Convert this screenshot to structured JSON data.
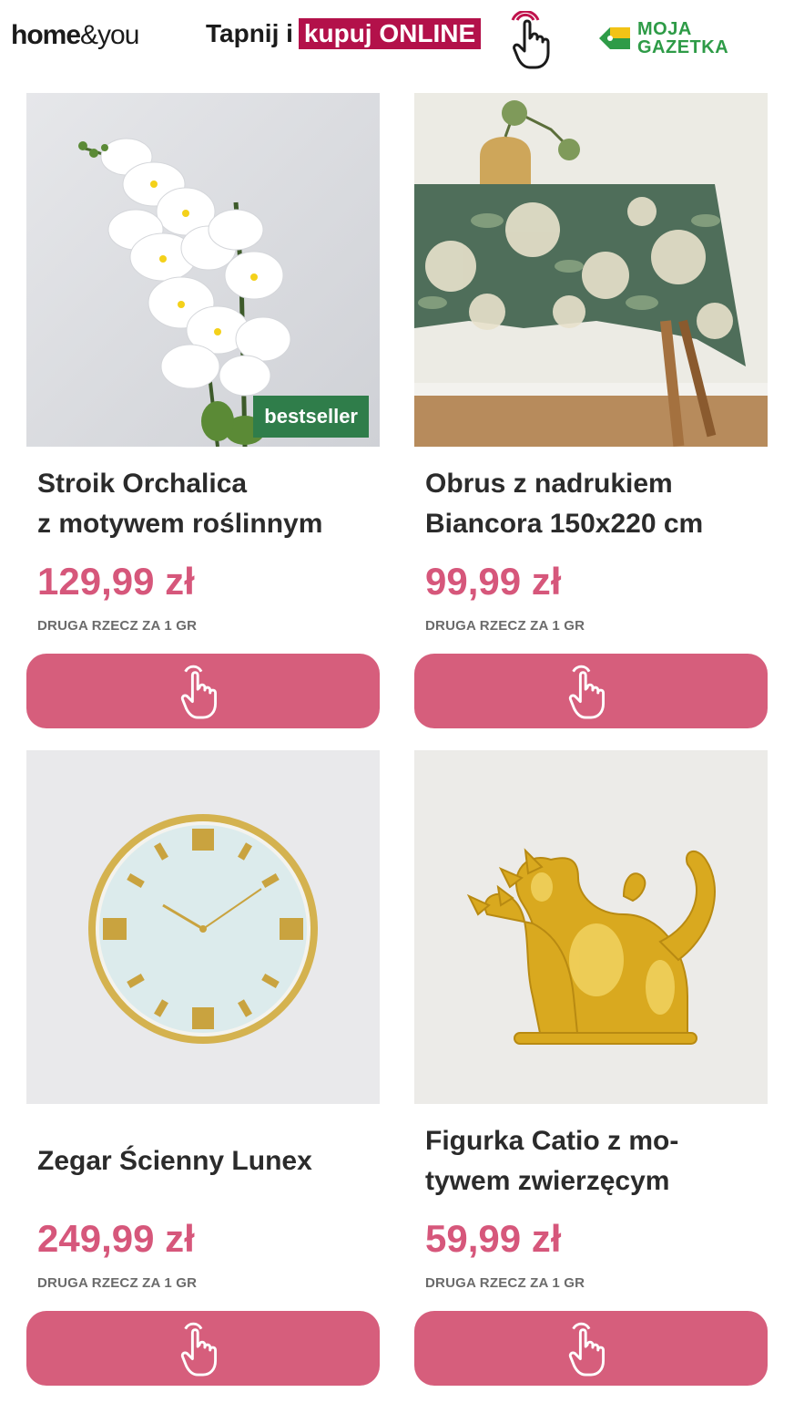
{
  "header": {
    "logo_home": "home",
    "logo_you": "&you",
    "promo_text": "Tapnij i",
    "promo_badge": "kupuj ONLINE",
    "mg_line1": "MOJA",
    "mg_line2": "GAZETKA",
    "colors": {
      "badge": "#b3114a",
      "mg_green": "#2e9b47"
    }
  },
  "products": [
    {
      "title_line1": "Stroik Orchalica",
      "title_line2": "z motywem roślinnym",
      "price": "129,99 zł",
      "offer": "DRUGA RZECZ ZA 1 GR",
      "badge": "bestseller",
      "button_icon": "tap-hand-icon"
    },
    {
      "title_line1": "Obrus z nadrukiem",
      "title_line2": "Biancora 150x220 cm",
      "price": "99,99 zł",
      "offer": "DRUGA RZECZ ZA 1 GR",
      "button_icon": "tap-hand-icon"
    },
    {
      "title_line1": "Zegar Ścienny Lunex",
      "title_line2": "",
      "price": "249,99 zł",
      "offer": "DRUGA RZECZ ZA 1 GR",
      "button_icon": "tap-hand-icon"
    },
    {
      "title_line1": "Figurka Catio z mo-",
      "title_line2": "tywem zwierzęcym",
      "price": "59,99 zł",
      "offer": "DRUGA RZECZ ZA 1 GR",
      "button_icon": "tap-hand-icon"
    }
  ],
  "colors": {
    "price": "#d6577b",
    "button": "#d65e7c",
    "bestseller_badge": "#2f7d4a"
  }
}
